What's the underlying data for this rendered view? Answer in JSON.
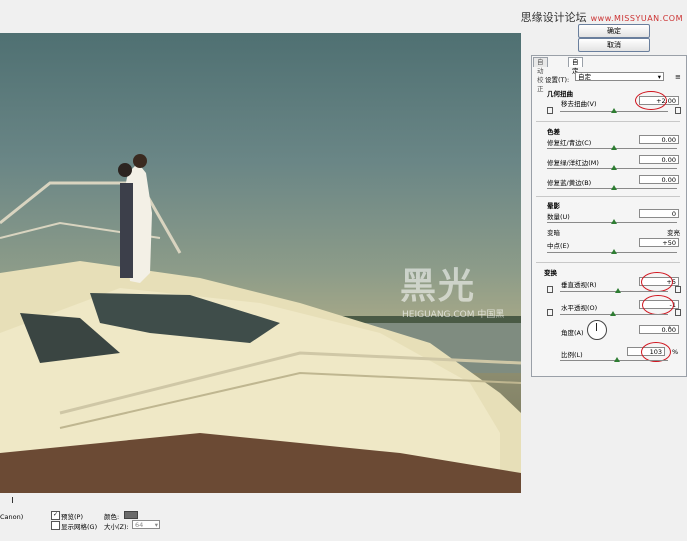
{
  "header": {
    "watermark_cn": "思缘设计论坛",
    "watermark_url": "www.MISSYUAN.COM",
    "ok_label": "确定",
    "cancel_label": "取消"
  },
  "photo": {
    "watermark_logo": "黑光",
    "watermark_sub": "HEIGUANG.COM 中国黑"
  },
  "tabs": {
    "auto": "自动校正",
    "custom": "自定"
  },
  "settings": {
    "label": "设置(T):",
    "value": "自定"
  },
  "geometric": {
    "heading": "几何扭曲",
    "distortion_label": "移去扭曲(V)",
    "distortion_value": "+2.00"
  },
  "chromatic": {
    "heading": "色差",
    "red_cyan_label": "修复红/青边(C)",
    "red_cyan_value": "0.00",
    "green_magenta_label": "修复绿/洋红边(M)",
    "green_magenta_value": "0.00",
    "blue_yellow_label": "修复蓝/黄边(B)",
    "blue_yellow_value": "0.00"
  },
  "vignette": {
    "heading": "晕影",
    "amount_label": "数量(U)",
    "amount_value": "0",
    "darken": "变暗",
    "lighten": "变亮",
    "midpoint_label": "中点(E)",
    "midpoint_value": "+50"
  },
  "transform": {
    "heading": "变换",
    "vertical_label": "垂直透视(R)",
    "vertical_value": "+5",
    "horizontal_label": "水平透视(O)",
    "horizontal_value": "-1",
    "angle_label": "角度(A)",
    "angle_value": "0.00",
    "angle_unit": "°",
    "scale_label": "比例(L)",
    "scale_value": "103",
    "scale_unit": "%"
  },
  "bottom": {
    "left_text": "Canon)",
    "preview_label": "预览(P)",
    "grid_label": "显示网格(G)",
    "color_label": "颜色:",
    "size_label": "大小(Z):",
    "size_value": "64"
  },
  "colors": {
    "highlight_ring": "#d0141e",
    "slider_thumb": "#2e7d32"
  }
}
